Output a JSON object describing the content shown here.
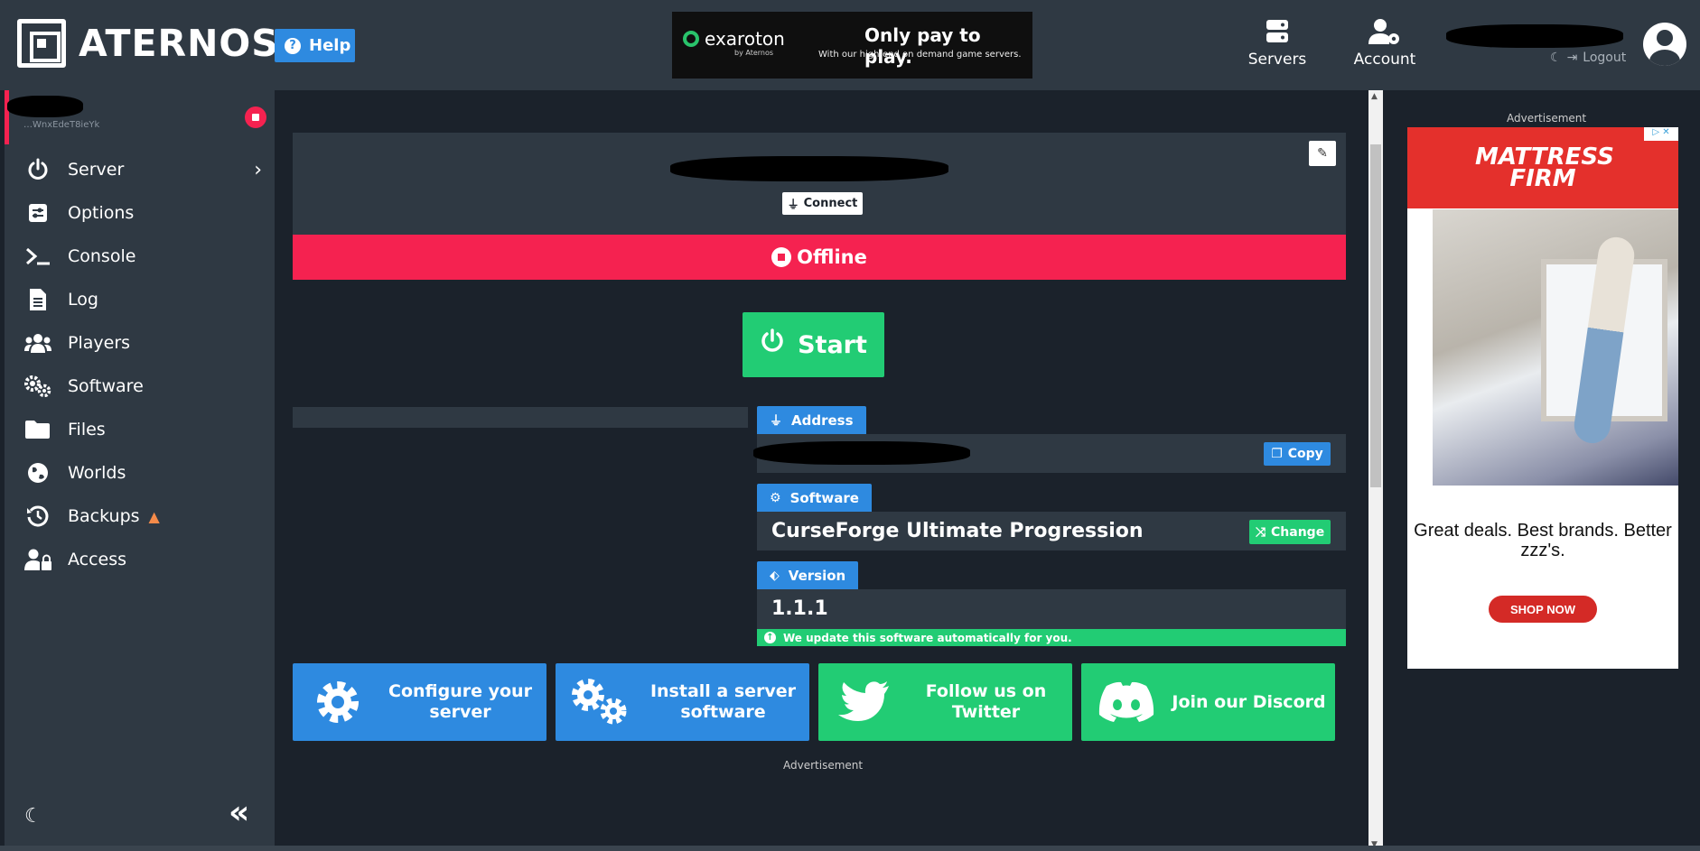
{
  "header": {
    "logo_text": "ATERNOS",
    "help_label": "Help",
    "top_ad": {
      "brand": "exaroton",
      "brand_sub": "by Aternos",
      "title": "Only pay to play.",
      "subtitle": "With our high-end on demand game servers."
    },
    "nav": {
      "servers_label": "Servers",
      "account_label": "Account"
    },
    "logout_label": "Logout"
  },
  "sidebar": {
    "server_id": "…WnxEdeT8ieYk",
    "items": [
      {
        "label": "Server",
        "icon": "power-icon"
      },
      {
        "label": "Options",
        "icon": "sliders-icon"
      },
      {
        "label": "Console",
        "icon": "terminal-icon"
      },
      {
        "label": "Log",
        "icon": "file-icon"
      },
      {
        "label": "Players",
        "icon": "users-icon"
      },
      {
        "label": "Software",
        "icon": "gears-icon"
      },
      {
        "label": "Files",
        "icon": "folder-icon"
      },
      {
        "label": "Worlds",
        "icon": "globe-icon"
      },
      {
        "label": "Backups",
        "icon": "history-icon"
      },
      {
        "label": "Access",
        "icon": "user-lock-icon"
      }
    ]
  },
  "main": {
    "connect_label": "Connect",
    "status": "Offline",
    "start_label": "Start",
    "address_tag": "Address",
    "copy_label": "Copy",
    "software_tag": "Software",
    "software_value": "CurseForge Ultimate Progression",
    "change_label": "Change",
    "version_tag": "Version",
    "version_value": "1.1.1",
    "auto_note": "We update this software automatically for you.",
    "cta": [
      {
        "label": "Configure your server",
        "icon": "gear-icon"
      },
      {
        "label": "Install a server software",
        "icon": "gears-icon"
      },
      {
        "label": "Follow us on Twitter",
        "icon": "twitter-icon"
      },
      {
        "label": "Join our Discord",
        "icon": "discord-icon"
      }
    ],
    "ad_label": "Advertisement"
  },
  "right_ad": {
    "label": "Advertisement",
    "brand": "MATTRESS FIRM",
    "message": "Great deals. Best brands. Better zzz's.",
    "button": "SHOP NOW"
  },
  "colors": {
    "header_bg": "#2f3943",
    "page_bg": "#1b222b",
    "status_offline": "#f52250",
    "accent_blue": "#2e8ae0",
    "accent_green": "#22cc74"
  }
}
